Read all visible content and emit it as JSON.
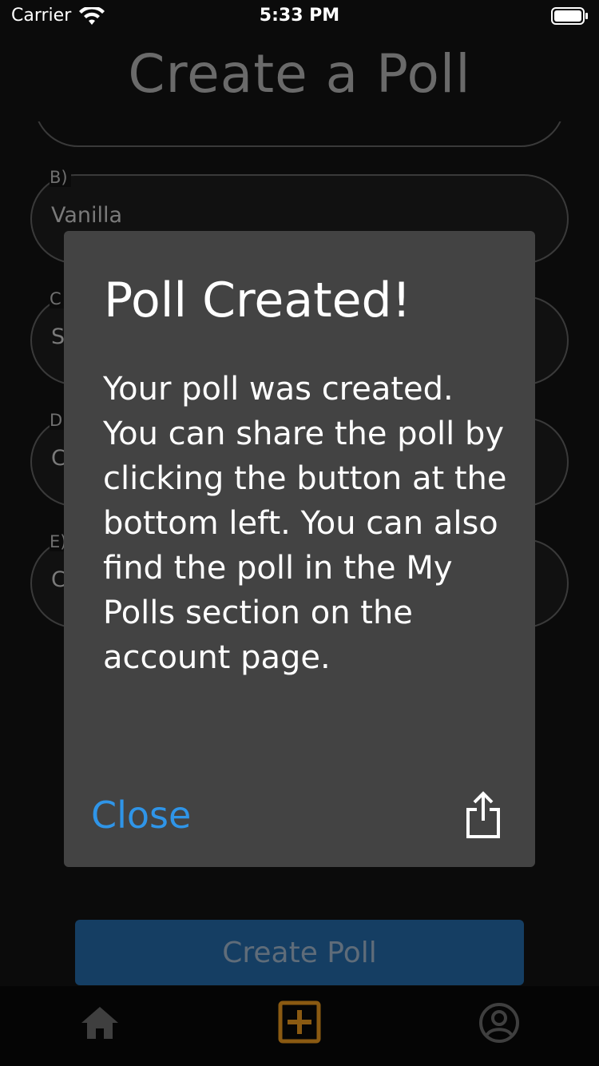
{
  "status_bar": {
    "carrier": "Carrier",
    "time": "5:33 PM"
  },
  "header": {
    "title": "Create a Poll"
  },
  "form": {
    "fields": [
      {
        "label": "B)",
        "value": "Vanilla"
      },
      {
        "label": "C",
        "value": "S"
      },
      {
        "label": "D",
        "value": "C"
      },
      {
        "label": "E)",
        "value": "C"
      }
    ],
    "submit_label": "Create Poll"
  },
  "dialog": {
    "title": "Poll Created!",
    "message": "Your poll was created. You can share the poll by clicking the button at the bottom left. You can also find the poll in the My Polls section on the account page.",
    "close_label": "Close",
    "share_icon": "share-icon"
  },
  "tab_bar": {
    "items": [
      {
        "icon": "home-icon"
      },
      {
        "icon": "add-box-icon",
        "active": true
      },
      {
        "icon": "account-circle-icon"
      }
    ]
  },
  "colors": {
    "accent_link": "#2f95e8",
    "active_tab": "#8a5a12",
    "dialog_bg": "#434343",
    "button_bg": "#153e63"
  }
}
